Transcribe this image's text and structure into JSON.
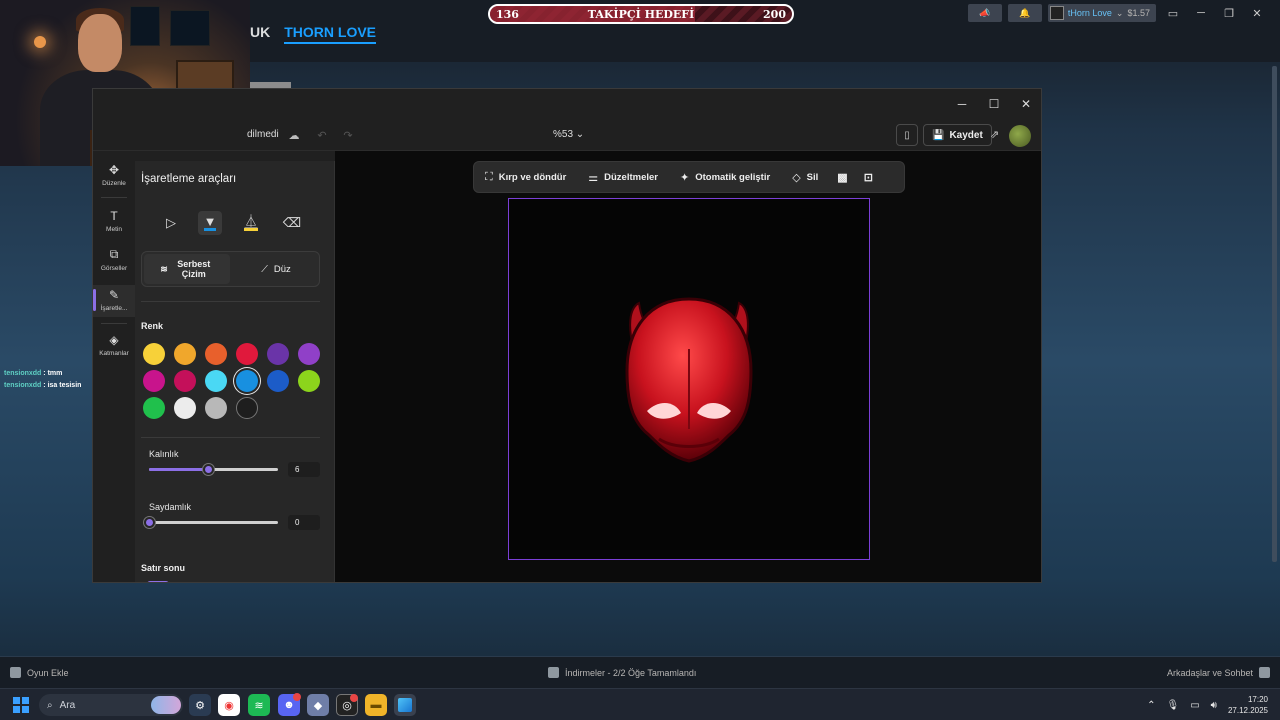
{
  "stream_goal": {
    "label": "TAKİPÇİ HEDEFİ",
    "current": "136",
    "target": "200",
    "progress": 0.68
  },
  "steam": {
    "nav": [
      "UK",
      "THORN LOVE"
    ],
    "account": {
      "username": "tHorn Love",
      "balance": "$1.57"
    },
    "bottom": {
      "add_game": "Oyun Ekle",
      "downloads": "İndirmeler - 2/2 Öğe Tamamlandı",
      "friends": "Arkadaşlar ve Sohbet"
    }
  },
  "chat": [
    {
      "user": "tensionxdd",
      "message": ": tmm"
    },
    {
      "user": "tensionxdd",
      "message": ": isa tesisin"
    }
  ],
  "photos": {
    "status": "dilmedi",
    "zoom": "%53",
    "save_label": "Kaydet",
    "rail": [
      "Düzenle",
      "Metin",
      "Görseller",
      "İşaretle...",
      "Katmanlar"
    ],
    "panel": {
      "title": "İşaretleme araçları",
      "mode_free": "Serbest Çizim",
      "mode_line": "Düz",
      "color_label": "Renk",
      "colors": [
        "#f7d139",
        "#f0a72c",
        "#e8602c",
        "#e0193c",
        "#6a34a8",
        "#9040c8",
        "#c8148c",
        "#c4105a",
        "#4ad8f4",
        "#1890e0",
        "#1c5cc8",
        "#8cd41c",
        "#20c04c",
        "#ececec",
        "#b8b8b8",
        "#1e1e1e"
      ],
      "selected_color": 9,
      "thickness_label": "Kalınlık",
      "thickness": "6",
      "thickness_ratio": 0.46,
      "opacity_label": "Saydamlık",
      "opacity": "0",
      "opacity_ratio": 0.0,
      "line_end_label": "Satır sonu"
    },
    "edit_toolbar": [
      "Kırp ve döndür",
      "Düzeltmeler",
      "Otomatik geliştir",
      "Sil"
    ]
  },
  "taskbar": {
    "search_placeholder": "Ara",
    "time": "17:20",
    "date": "27.12.2025"
  }
}
